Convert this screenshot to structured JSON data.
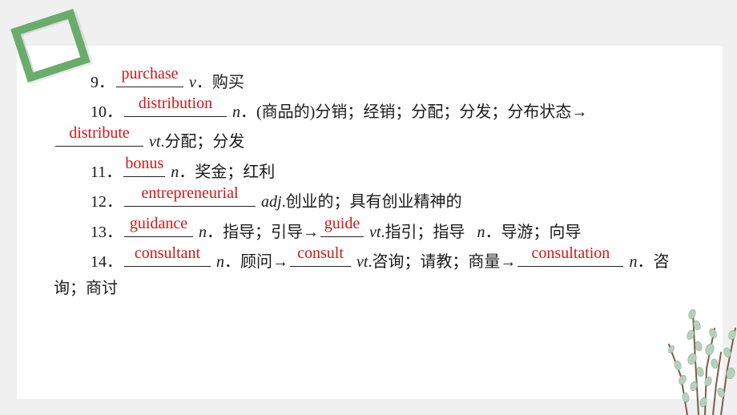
{
  "items": [
    {
      "number": "9．",
      "answer": "purchase",
      "pos": "v",
      "pos_sep": "．",
      "meaning": "购买"
    },
    {
      "number": "10．",
      "answer": "distribution",
      "pos": "n",
      "pos_sep": "．",
      "meaning": "(商品的)分销；经销；分配；分发；分布状态→",
      "derived": {
        "answer": "distribute",
        "pos": "vt",
        "pos_sep": ".",
        "meaning": "分配；分发"
      }
    },
    {
      "number": "11．",
      "answer": "bonus",
      "pos": "n",
      "pos_sep": "．",
      "meaning": "奖金；红利"
    },
    {
      "number": "12．",
      "answer": "entrepreneurial",
      "pos": "adj",
      "pos_sep": ".",
      "meaning": "创业的；具有创业精神的"
    },
    {
      "number": "13．",
      "answer": "guidance",
      "pos": "n",
      "pos_sep": "．",
      "meaning": "指导；引导→",
      "derived": {
        "answer": "guide",
        "pos": "vt",
        "pos_sep": ".",
        "meaning": "指引；指导",
        "pos2": "n",
        "pos2_sep": "．",
        "meaning2": "导游；向导"
      }
    },
    {
      "number": "14．",
      "answer": "consultant",
      "pos": "n",
      "pos_sep": "．",
      "meaning": "顾问→",
      "derived": {
        "answer": "consult",
        "pos": "vt",
        "pos_sep": ".",
        "meaning": "咨询；请教；商量→"
      },
      "derived2": {
        "answer": "consultation",
        "pos": "n",
        "pos_sep": "．",
        "meaning_line1": "咨",
        "meaning_line2": "询；商讨"
      }
    }
  ],
  "colors": {
    "answer": "#d0161a",
    "frame": "#6aac6c",
    "background": "#f0f0f0"
  }
}
